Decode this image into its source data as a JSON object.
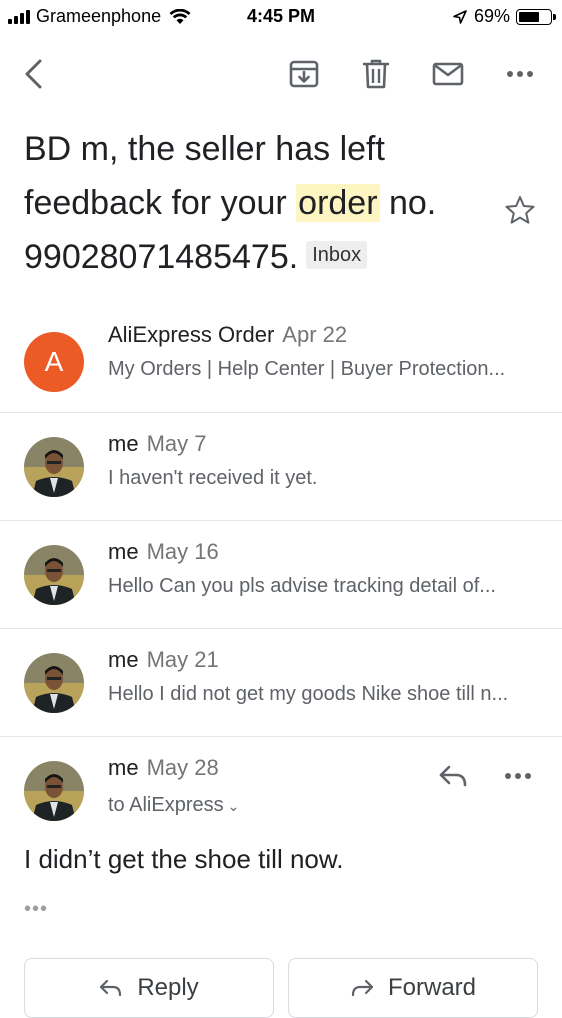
{
  "status_bar": {
    "carrier": "Grameenphone",
    "time": "4:45 PM",
    "battery_percent": "69%",
    "battery_level": 0.69
  },
  "toolbar": {
    "icons": [
      "back-arrow-icon",
      "archive-icon",
      "trash-icon",
      "mail-icon",
      "more-icon"
    ]
  },
  "email": {
    "subject_before": "BD m, the seller has left feedback for your ",
    "subject_highlight": "order",
    "subject_after": " no. 99028071485475.",
    "label": "Inbox",
    "starred": false
  },
  "messages": [
    {
      "sender": "AliExpress Order",
      "date": "Apr 22",
      "avatar_letter": "A",
      "avatar_color": "#ec5b26",
      "snippet": "My Orders | Help Center | Buyer Protection..."
    },
    {
      "sender": "me",
      "date": "May 7",
      "snippet": "I haven't received it yet."
    },
    {
      "sender": "me",
      "date": "May 16",
      "snippet": "Hello Can you pls advise tracking detail of..."
    },
    {
      "sender": "me",
      "date": "May 21",
      "snippet": "Hello I did not get my goods Nike shoe till n..."
    }
  ],
  "expanded_message": {
    "sender": "me",
    "date": "May 28",
    "to": "to AliExpress",
    "body": "I didn’t get the shoe till now.",
    "trimmed_indicator": "•••"
  },
  "actions": {
    "reply_label": "Reply",
    "forward_label": "Forward"
  },
  "colors": {
    "accent_avatar": "#ec5b26",
    "highlight": "#fdf5c2"
  }
}
